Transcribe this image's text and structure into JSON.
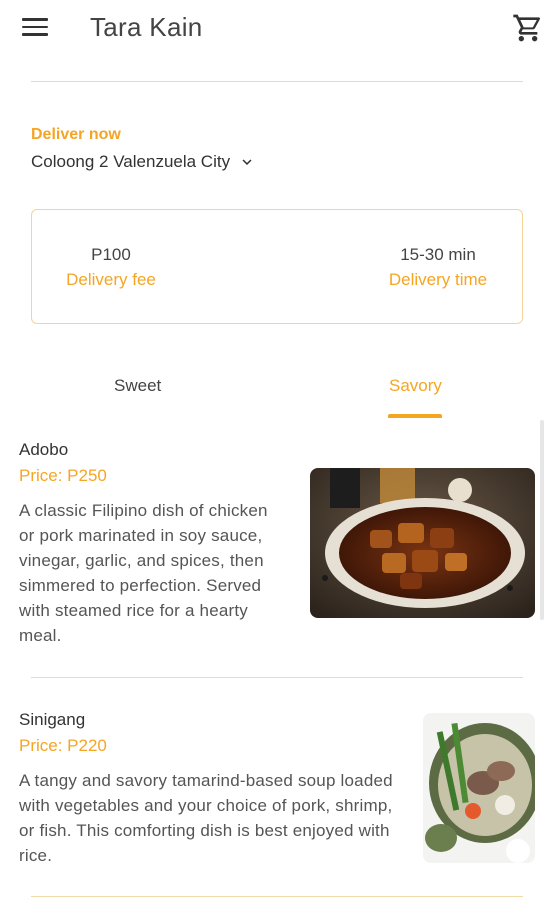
{
  "app": {
    "title": "Tara Kain"
  },
  "icons": {
    "menu": "menu-icon",
    "cart": "cart-icon",
    "dropdown": "chevron-down-icon"
  },
  "colors": {
    "accent": "#f5a524",
    "text": "#333333"
  },
  "delivery": {
    "label": "Deliver now",
    "location": "Coloong 2 Valenzuela City"
  },
  "info": {
    "fee_value": "P100",
    "fee_label": "Delivery fee",
    "time_value": "15-30 min",
    "time_label": "Delivery time"
  },
  "tabs": [
    {
      "label": "Sweet",
      "active": false
    },
    {
      "label": "Savory",
      "active": true
    }
  ],
  "menu_items": [
    {
      "name": "Adobo",
      "price": "Price: P250",
      "description": "A classic Filipino dish of chicken or pork marinated in soy sauce, vinegar, garlic, and spices, then simmered to perfection. Served with steamed rice for a hearty meal."
    },
    {
      "name": "Sinigang",
      "price": "Price: P220",
      "description": "A tangy and savory tamarind-based soup loaded with vegetables and your choice of pork, shrimp, or fish. This comforting dish is best enjoyed with rice."
    }
  ]
}
